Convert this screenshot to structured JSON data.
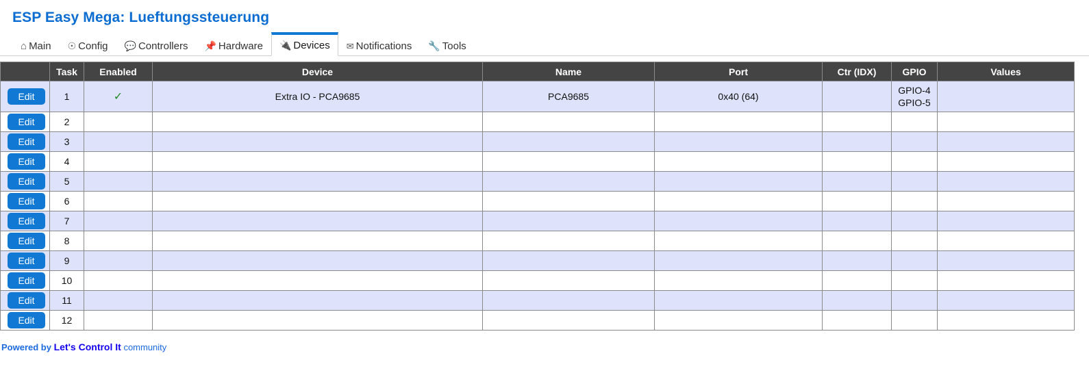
{
  "header": {
    "title": "ESP Easy Mega: Lueftungssteuerung"
  },
  "nav": {
    "items": [
      {
        "label": "Main",
        "icon": "home-icon",
        "glyph": "⌂",
        "active": false
      },
      {
        "label": "Config",
        "icon": "gear-icon",
        "glyph": "☉",
        "active": false
      },
      {
        "label": "Controllers",
        "icon": "speech-bubble-icon",
        "glyph": "💬",
        "active": false
      },
      {
        "label": "Hardware",
        "icon": "pushpin-icon",
        "glyph": "📌",
        "active": false
      },
      {
        "label": "Devices",
        "icon": "plug-icon",
        "glyph": "🔌",
        "active": true
      },
      {
        "label": "Notifications",
        "icon": "envelope-icon",
        "glyph": "✉",
        "active": false
      },
      {
        "label": "Tools",
        "icon": "wrench-icon",
        "glyph": "🔧",
        "active": false
      }
    ]
  },
  "devices_table": {
    "columns": [
      "",
      "Task",
      "Enabled",
      "Device",
      "Name",
      "Port",
      "Ctr (IDX)",
      "GPIO",
      "Values"
    ],
    "edit_label": "Edit",
    "enabled_glyph": "✓",
    "rows": [
      {
        "task": "1",
        "enabled": true,
        "device": "Extra IO - PCA9685",
        "name": "PCA9685",
        "port": "0x40 (64)",
        "ctr": "",
        "gpio": [
          "GPIO-4",
          "GPIO-5"
        ],
        "values": ""
      },
      {
        "task": "2",
        "enabled": false,
        "device": "",
        "name": "",
        "port": "",
        "ctr": "",
        "gpio": [],
        "values": ""
      },
      {
        "task": "3",
        "enabled": false,
        "device": "",
        "name": "",
        "port": "",
        "ctr": "",
        "gpio": [],
        "values": ""
      },
      {
        "task": "4",
        "enabled": false,
        "device": "",
        "name": "",
        "port": "",
        "ctr": "",
        "gpio": [],
        "values": ""
      },
      {
        "task": "5",
        "enabled": false,
        "device": "",
        "name": "",
        "port": "",
        "ctr": "",
        "gpio": [],
        "values": ""
      },
      {
        "task": "6",
        "enabled": false,
        "device": "",
        "name": "",
        "port": "",
        "ctr": "",
        "gpio": [],
        "values": ""
      },
      {
        "task": "7",
        "enabled": false,
        "device": "",
        "name": "",
        "port": "",
        "ctr": "",
        "gpio": [],
        "values": ""
      },
      {
        "task": "8",
        "enabled": false,
        "device": "",
        "name": "",
        "port": "",
        "ctr": "",
        "gpio": [],
        "values": ""
      },
      {
        "task": "9",
        "enabled": false,
        "device": "",
        "name": "",
        "port": "",
        "ctr": "",
        "gpio": [],
        "values": ""
      },
      {
        "task": "10",
        "enabled": false,
        "device": "",
        "name": "",
        "port": "",
        "ctr": "",
        "gpio": [],
        "values": ""
      },
      {
        "task": "11",
        "enabled": false,
        "device": "",
        "name": "",
        "port": "",
        "ctr": "",
        "gpio": [],
        "values": ""
      },
      {
        "task": "12",
        "enabled": false,
        "device": "",
        "name": "",
        "port": "",
        "ctr": "",
        "gpio": [],
        "values": ""
      }
    ]
  },
  "footer": {
    "powered_by": "Powered by",
    "brand": "Let's Control It",
    "suffix": "community"
  },
  "colors": {
    "title_blue": "#0b6dd1",
    "accent_blue": "#1179d4",
    "header_dark": "#444444",
    "row_alt": "#dee3fb",
    "check_green": "#1f8a23",
    "brand_blue": "#1300ee"
  }
}
